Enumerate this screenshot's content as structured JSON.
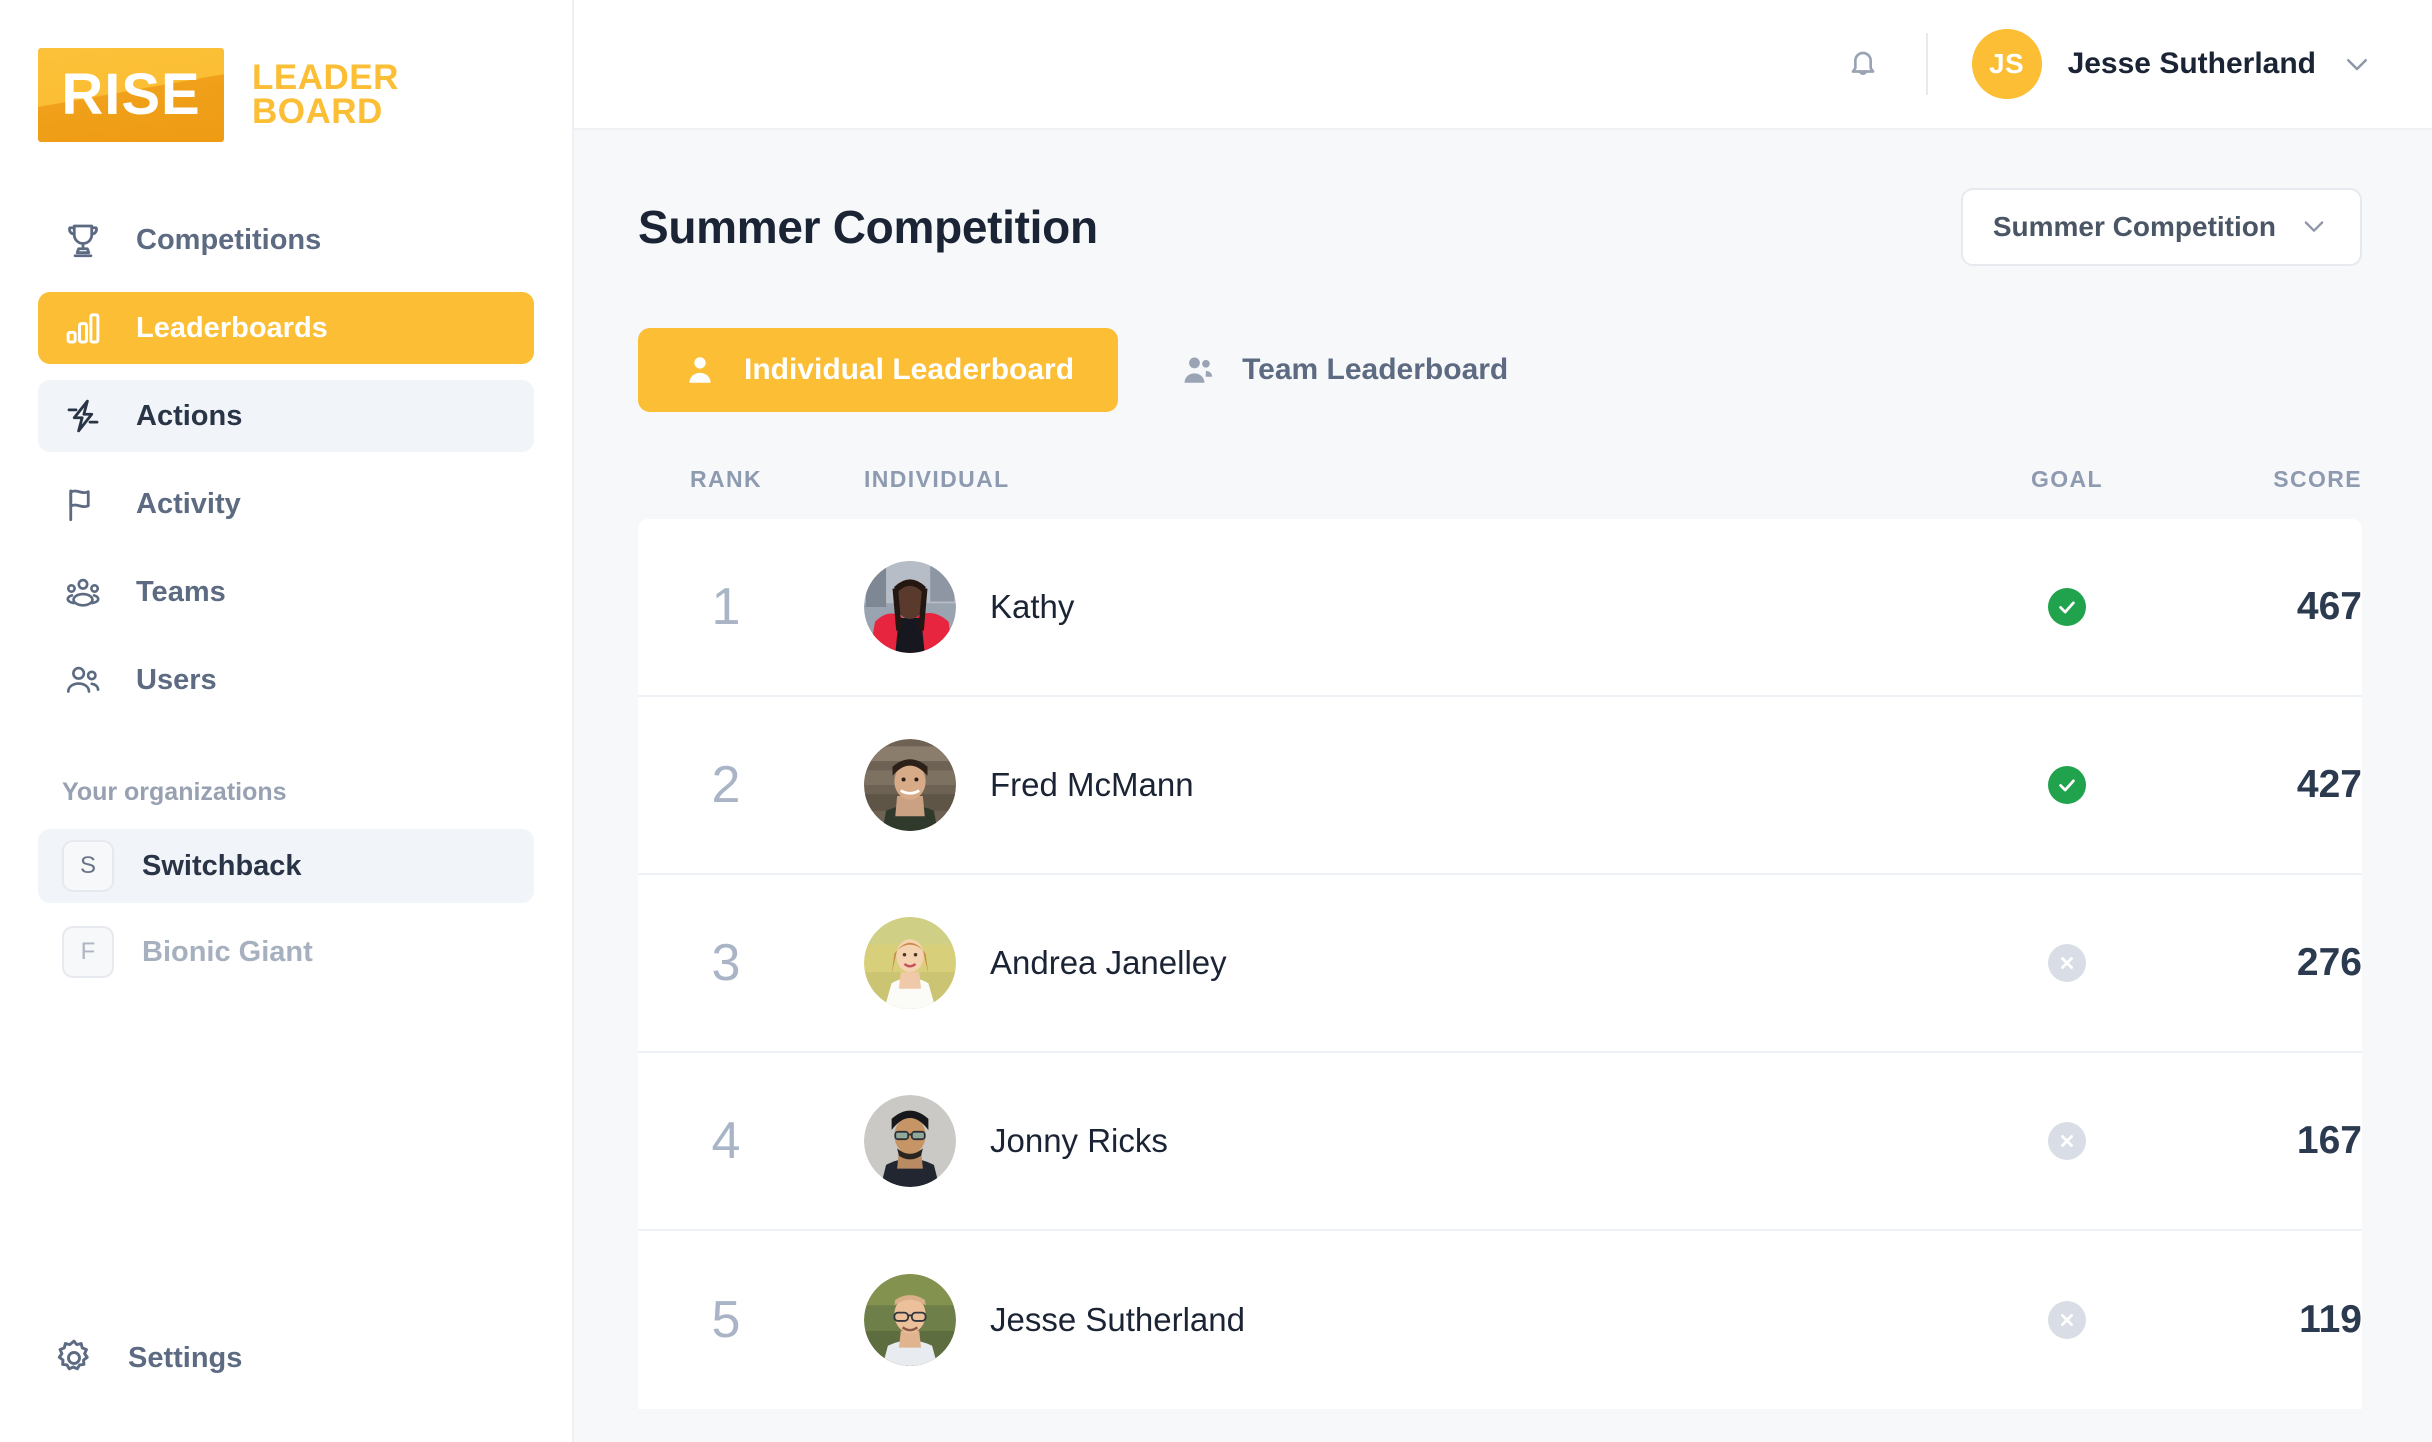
{
  "brand": {
    "mark_text": "RISE",
    "word_line1": "LEADER",
    "word_line2": "BOARD",
    "accent": "#FBBE34"
  },
  "sidebar": {
    "nav_items": [
      {
        "label": "Competitions",
        "icon": "trophy-icon",
        "state": "plain"
      },
      {
        "label": "Leaderboards",
        "icon": "bar-chart-icon",
        "state": "active"
      },
      {
        "label": "Actions",
        "icon": "lightning-bolt-icon",
        "state": "hover"
      },
      {
        "label": "Activity",
        "icon": "flag-icon",
        "state": "plain"
      },
      {
        "label": "Teams",
        "icon": "people-group-icon",
        "state": "plain"
      },
      {
        "label": "Users",
        "icon": "users-icon",
        "state": "plain"
      }
    ],
    "org_heading": "Your organizations",
    "organizations": [
      {
        "initial": "S",
        "label": "Switchback",
        "state": "selected"
      },
      {
        "initial": "F",
        "label": "Bionic Giant",
        "state": "dim"
      }
    ],
    "settings_label": "Settings"
  },
  "topbar": {
    "bell_icon": "notification-bell-icon",
    "user_initials": "JS",
    "user_name": "Jesse Sutherland",
    "chevron_icon": "chevron-down-icon"
  },
  "page": {
    "title": "Summer Competition",
    "competition_select_value": "Summer Competition"
  },
  "tabs": [
    {
      "label": "Individual Leaderboard",
      "icon": "person-icon",
      "active": true
    },
    {
      "label": "Team Leaderboard",
      "icon": "two-people-icon",
      "active": false
    }
  ],
  "table": {
    "headers": {
      "rank": "RANK",
      "individual": "INDIVIDUAL",
      "goal": "GOAL",
      "score": "SCORE"
    },
    "rows": [
      {
        "rank": "1",
        "name": "Kathy",
        "goal_met": true,
        "score": "467",
        "photo": "woman-red-jacket"
      },
      {
        "rank": "2",
        "name": "Fred McMann",
        "goal_met": true,
        "score": "427",
        "photo": "man-plaid-shirt"
      },
      {
        "rank": "3",
        "name": "Andrea Janelley",
        "goal_met": false,
        "score": "276",
        "photo": "woman-white-dress"
      },
      {
        "rank": "4",
        "name": "Jonny Ricks",
        "goal_met": false,
        "score": "167",
        "photo": "man-glasses-beard"
      },
      {
        "rank": "5",
        "name": "Jesse Sutherland",
        "goal_met": false,
        "score": "119",
        "photo": "man-glasses-bald"
      }
    ]
  },
  "colors": {
    "accent": "#FBBE34",
    "goal_met": "#21A24C",
    "goal_unmet": "#D9DEE6",
    "text_dark": "#1B2434",
    "text_muted": "#5D6B82",
    "bg_main": "#F7F8FA"
  }
}
